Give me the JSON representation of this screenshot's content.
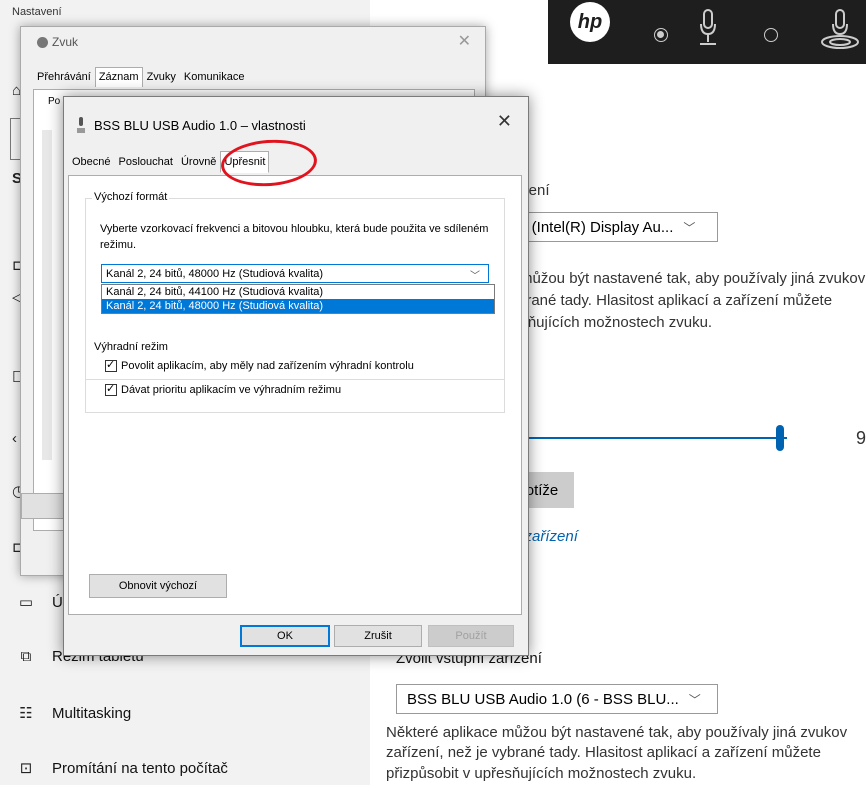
{
  "settings": {
    "window_title": "Nastavení",
    "nav": {
      "item_u": "Ú",
      "tablet": "Režim tabletu",
      "multitasking": "Multitasking",
      "projection": "Promítání na tento počítač"
    },
    "right": {
      "output_device_heading_fragment": "řízení",
      "output_dropdown": "M (Intel(R) Display Au...",
      "output_note_line1": "můžou být nastavené tak, aby používaly jiná zvukov",
      "output_note_line2": "brané tady. Hlasitost aplikací a zařízení můžete",
      "output_note_line3": "esňujících možnostech zvuku.",
      "device_props_link_fragment": "í",
      "volume_value": "9",
      "troubleshoot_button": "otíže",
      "manage_devices_link": "á zařízení",
      "input_heading": "Zvolit vstupní zařízení",
      "input_dropdown": "BSS BLU USB Audio 1.0  (6 - BSS BLU...",
      "input_note_line1": "Některé aplikace můžou být nastavené tak, aby používaly jiná zvukov",
      "input_note_line2": "zařízení, než je vybrané tady. Hlasitost aplikací a zařízení můžete",
      "input_note_line3": "přizpůsobit v upřesňujících možnostech zvuku."
    },
    "hp_bar_logo": "hp"
  },
  "zvuk_dialog": {
    "title": "Zvuk",
    "tabs": [
      "Přehrávání",
      "Záznam",
      "Zvuky",
      "Komunikace"
    ],
    "active_tab": "Záznam",
    "desc_fragment": "Po"
  },
  "props_dialog": {
    "title": "BSS BLU USB Audio 1.0  – vlastnosti",
    "tabs": [
      "Obecné",
      "Poslouchat",
      "Úrovně",
      "Upřesnit"
    ],
    "active_tab": "Upřesnit",
    "default_format": {
      "label": "Výchozí formát",
      "description": "Vyberte vzorkovací frekvenci a bitovou hloubku, která bude použita ve sdíleném režimu.",
      "selected": "Kanál 2, 24 bitů, 48000 Hz (Studiová kvalita)",
      "options": [
        "Kanál 2, 24 bitů, 44100 Hz (Studiová kvalita)",
        "Kanál 2, 24 bitů, 48000 Hz (Studiová kvalita)"
      ],
      "highlighted_index": 1
    },
    "exclusive_mode": {
      "label": "Výhradní režim",
      "option1": "Povolit aplikacím, aby měly nad zařízením výhradní kontrolu",
      "option1_checked": true,
      "option2": "Dávat prioritu aplikacím ve výhradním režimu",
      "option2_checked": true
    },
    "restore_default_button": "Obnovit výchozí",
    "ok_button": "OK",
    "cancel_button": "Zrušit",
    "apply_button": "Použít"
  },
  "colors": {
    "accent": "#0078d7",
    "settings_accent": "#0063b1",
    "annotation_circle": "#e0141e"
  }
}
